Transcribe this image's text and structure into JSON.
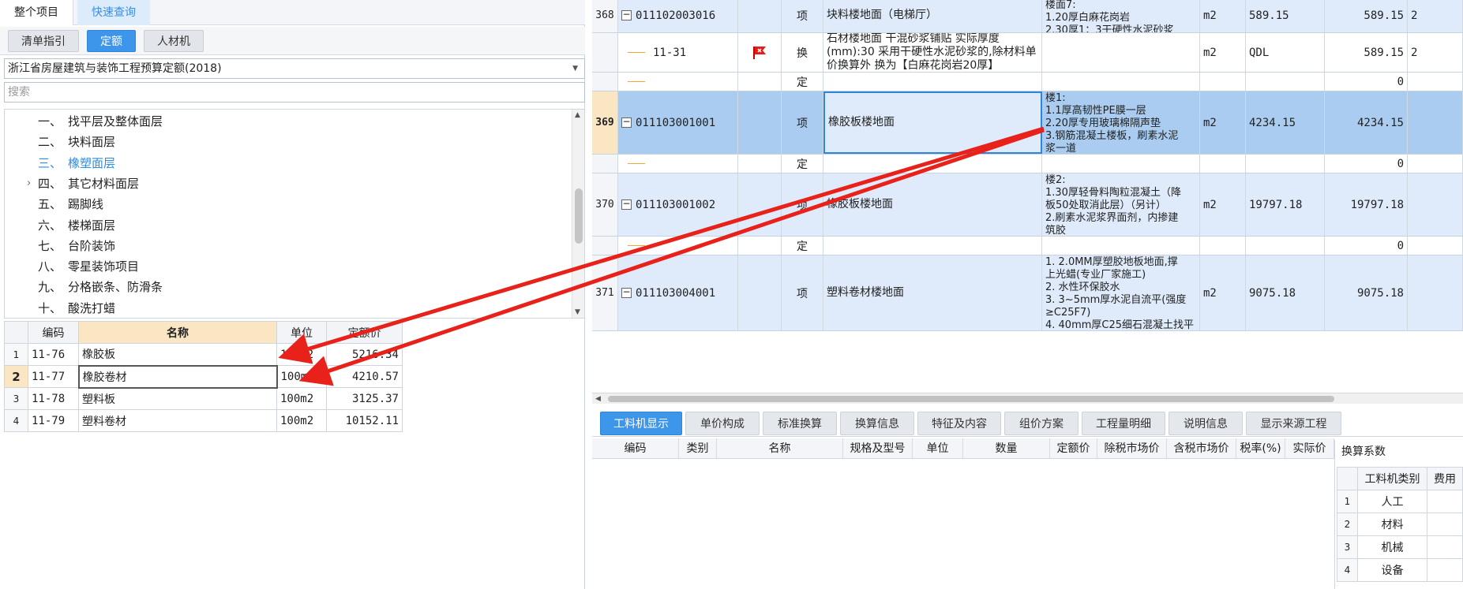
{
  "left": {
    "top_tabs": [
      "整个项目",
      "快速查询"
    ],
    "sub_tabs": [
      "清单指引",
      "定额",
      "人材机"
    ],
    "quota_library": "浙江省房屋建筑与装饰工程预算定额(2018)",
    "search_placeholder": "搜索",
    "tree": [
      {
        "num": "一、",
        "label": "找平层及整体面层"
      },
      {
        "num": "二、",
        "label": "块料面层"
      },
      {
        "num": "三、",
        "label": "橡塑面层",
        "selected": true
      },
      {
        "num": "四、",
        "label": "其它材料面层",
        "expandable": true
      },
      {
        "num": "五、",
        "label": "踢脚线"
      },
      {
        "num": "六、",
        "label": "楼梯面层"
      },
      {
        "num": "七、",
        "label": "台阶装饰"
      },
      {
        "num": "八、",
        "label": "零星装饰项目"
      },
      {
        "num": "九、",
        "label": "分格嵌条、防滑条"
      },
      {
        "num": "十、",
        "label": "酸洗打蜡"
      }
    ],
    "table": {
      "headers": [
        "编码",
        "名称",
        "单位",
        "定额价"
      ],
      "rows": [
        {
          "idx": "1",
          "code": "11-76",
          "name": "橡胶板",
          "unit": "100m2",
          "price": "5216.34"
        },
        {
          "idx": "2",
          "code": "11-77",
          "name": "橡胶卷材",
          "unit": "100m2",
          "price": "4210.57"
        },
        {
          "idx": "3",
          "code": "11-78",
          "name": "塑料板",
          "unit": "100m2",
          "price": "3125.37"
        },
        {
          "idx": "4",
          "code": "11-79",
          "name": "塑料卷材",
          "unit": "100m2",
          "price": "10152.11"
        }
      ]
    }
  },
  "grid": {
    "rows": [
      {
        "idx": "368",
        "code": "011102003016",
        "type": "项",
        "name": "块料楼地面（电梯厅）",
        "features": [
          "楼面7:",
          "1.20厚白麻花岗岩",
          "2.30厚1：3干硬性水泥砂浆"
        ],
        "unit": "m2",
        "qty": "589.15",
        "qty2": "589.15",
        "extra": "2"
      },
      {
        "idx": "",
        "code": "11-31",
        "type": "换",
        "name": "石材楼地面 干混砂浆铺贴 实际厚度(mm):30 采用干硬性水泥砂浆的,除材料单价换算外 换为【白麻花岗岩20厚】",
        "features": [],
        "unit": "m2",
        "qty": "QDL",
        "qty2": "589.15",
        "extra": "2"
      },
      {
        "idx": "",
        "code": "",
        "type": "定",
        "name": "",
        "features": [],
        "unit": "",
        "qty": "",
        "qty2": "0",
        "extra": ""
      },
      {
        "idx": "369",
        "code": "011103001001",
        "type": "项",
        "name": "橡胶板楼地面",
        "features": [
          "楼1:",
          "1.1厚高韧性PE膜一层",
          "2.20厚专用玻璃棉隔声垫",
          "3.钢筋混凝土楼板，刷素水泥",
          "浆一道"
        ],
        "unit": "m2",
        "qty": "4234.15",
        "qty2": "4234.15",
        "extra": ""
      },
      {
        "idx": "",
        "code": "",
        "type": "定",
        "name": "",
        "features": [],
        "unit": "",
        "qty": "",
        "qty2": "0",
        "extra": ""
      },
      {
        "idx": "370",
        "code": "011103001002",
        "type": "项",
        "name": "橡胶板楼地面",
        "features": [
          "楼2:",
          "1.30厚轻骨料陶粒混凝土（降",
          "板50处取消此层）（另计）",
          "2.刷素水泥浆界面剂，内掺建",
          "筑胶"
        ],
        "unit": "m2",
        "qty": "19797.18",
        "qty2": "19797.18",
        "extra": ""
      },
      {
        "idx": "",
        "code": "",
        "type": "定",
        "name": "",
        "features": [],
        "unit": "",
        "qty": "",
        "qty2": "0",
        "extra": ""
      },
      {
        "idx": "371",
        "code": "011103004001",
        "type": "项",
        "name": "塑料卷材楼地面",
        "features": [
          "1. 2.0MM厚塑胶地板地面,撑",
          "上光蜡(专业厂家施工)",
          "2. 水性环保胶水",
          "3. 3~5mm厚水泥自流平(强度",
          "≥C25F7)",
          "4. 40mm厚C25细石混凝土找平"
        ],
        "unit": "m2",
        "qty": "9075.18",
        "qty2": "9075.18",
        "extra": ""
      }
    ]
  },
  "bottom": {
    "tabs": [
      "工料机显示",
      "单价构成",
      "标准换算",
      "换算信息",
      "特征及内容",
      "组价方案",
      "工程量明细",
      "说明信息",
      "显示来源工程"
    ],
    "columns": [
      "编码",
      "类别",
      "名称",
      "规格及型号",
      "单位",
      "数量",
      "定额价",
      "除税市场价",
      "含税市场价",
      "税率(%)",
      "实际价"
    ],
    "coef": {
      "title": "换算系数",
      "headers": [
        "工料机类别",
        "费用"
      ],
      "rows": [
        {
          "idx": "1",
          "cat": "人工"
        },
        {
          "idx": "2",
          "cat": "材料"
        },
        {
          "idx": "3",
          "cat": "机械"
        },
        {
          "idx": "4",
          "cat": "设备"
        }
      ]
    }
  },
  "colors": {
    "accent": "#3d96ea",
    "selected_row": "#a9ccf0",
    "item_row": "#dfeafa",
    "arrow": "#e8221b",
    "header_highlight": "#fbe6c4"
  }
}
